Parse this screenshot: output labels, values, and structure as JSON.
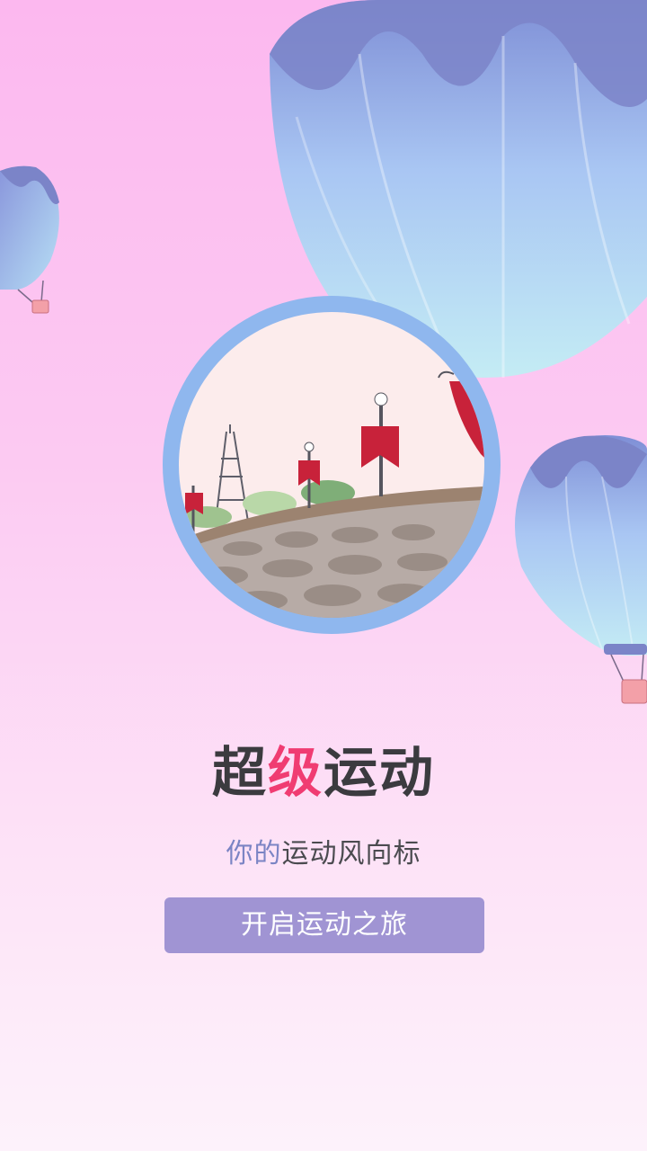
{
  "app": {
    "title_part1": "超",
    "title_highlight": "级",
    "title_part2": "运动",
    "subtitle_soft": "你的",
    "subtitle_rest": "运动风向标",
    "start_button_label": "开启运动之旅"
  },
  "colors": {
    "background_top": "#fcb8ef",
    "background_bottom": "#fdf2fb",
    "title_text": "#3b3b3f",
    "title_highlight": "#f03c72",
    "subtitle_soft": "#7b84c4",
    "button_bg": "#a094d3",
    "circle_border": "#8fb7ee"
  },
  "illustration": {
    "icons": [
      "hot-air-balloon-icon",
      "eiffel-tower-icon",
      "street-lamp-icon",
      "red-banner-icon",
      "cobblestone-road-icon"
    ]
  }
}
